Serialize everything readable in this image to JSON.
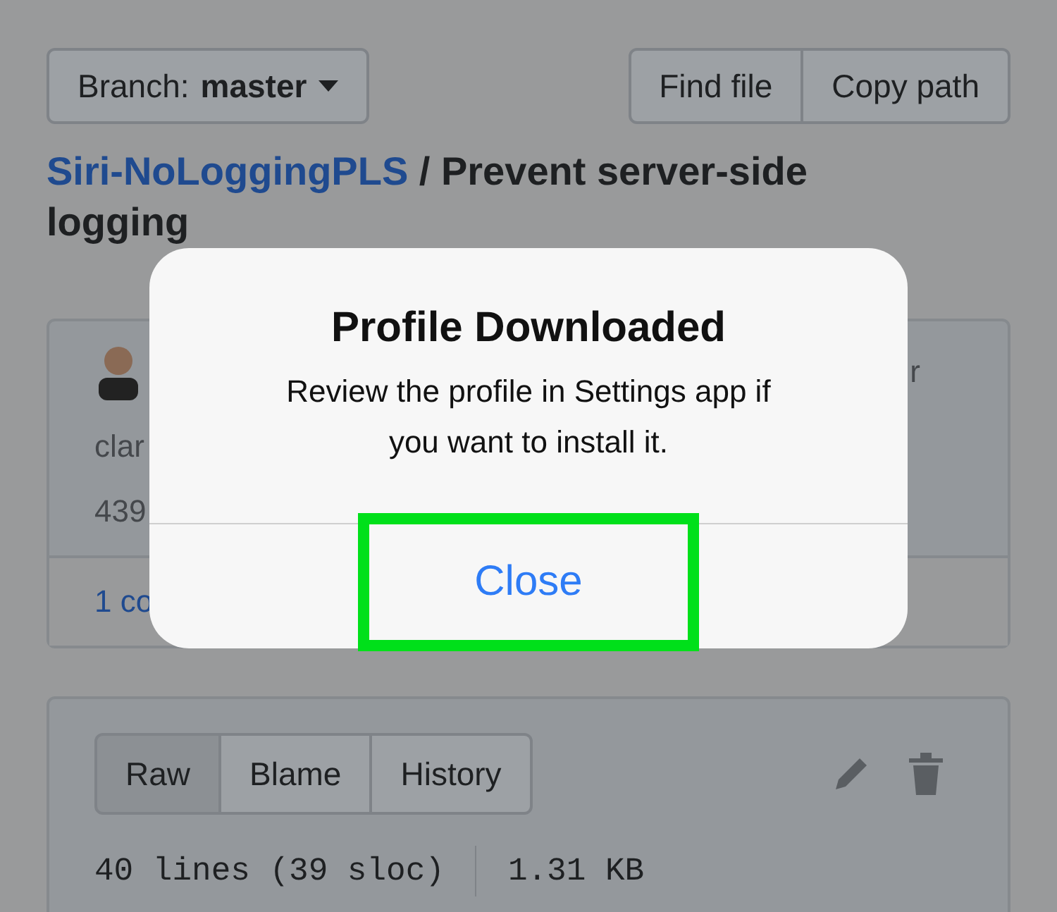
{
  "header": {
    "branch_label": "Branch:",
    "branch": "master",
    "buttons": [
      "Find file",
      "Copy path"
    ]
  },
  "breadcrumb": {
    "repo": "Siri-NoLoggingPLS",
    "separator": "/",
    "file": "Prevent server-side logging"
  },
  "commit": {
    "author": "clar",
    "right_text": "r",
    "count": "439",
    "contributors": "1 co"
  },
  "file": {
    "tabs": [
      {
        "label": "Raw",
        "selected": true
      },
      {
        "label": "Blame",
        "selected": false
      },
      {
        "label": "History",
        "selected": false
      }
    ],
    "lines": "40 lines (39 sloc)",
    "size": "1.31 KB"
  },
  "dialog": {
    "title": "Profile Downloaded",
    "message": "Review the profile in Settings app if you want to install it.",
    "button": "Close",
    "highlighted": true
  }
}
